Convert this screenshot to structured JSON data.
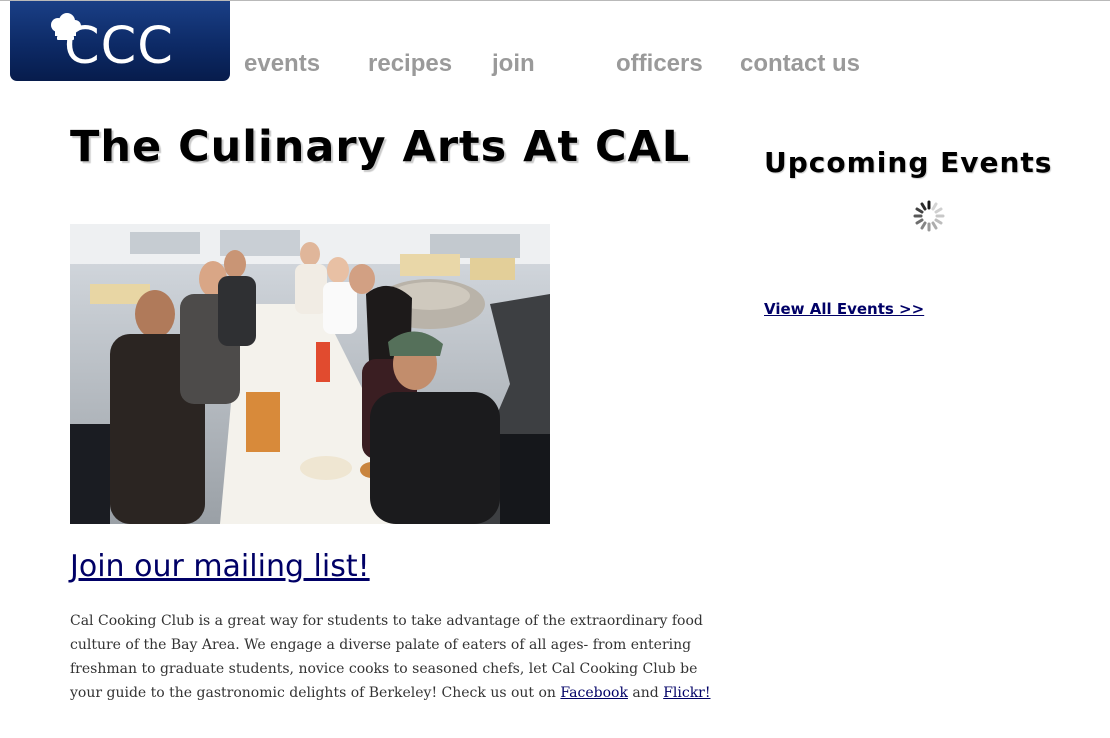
{
  "logo": {
    "text": "CCC",
    "icon": "chef-hat-icon",
    "gradient_top": "#1a3f86",
    "gradient_bottom": "#071c4c"
  },
  "nav": {
    "items": [
      {
        "label": "events"
      },
      {
        "label": "recipes"
      },
      {
        "label": "join"
      },
      {
        "label": "officers"
      },
      {
        "label": "contact us"
      }
    ],
    "color": "#9a9a9a"
  },
  "main": {
    "title": "The Culinary Arts At CAL",
    "photo_description_icon": "group-photo",
    "mailing_list_label": "Join our mailing list!",
    "intro": {
      "text": "Cal Cooking Club is a great way for students to take advantage of the extraordinary food culture of the Bay Area. We engage a diverse palate of eaters of all ages- from entering freshman to graduate students, novice cooks to seasoned chefs, let Cal Cooking Club be your guide to the gastronomic delights of Berkeley! Check us out on",
      "facebook_label": "Facebook",
      "and_text": "and",
      "flickr_label": "Flickr!"
    },
    "link_color": "#000066"
  },
  "sidebar": {
    "heading": "Upcoming Events",
    "loading_icon": "loading-spinner-icon",
    "view_all_label": "View All Events >>"
  }
}
